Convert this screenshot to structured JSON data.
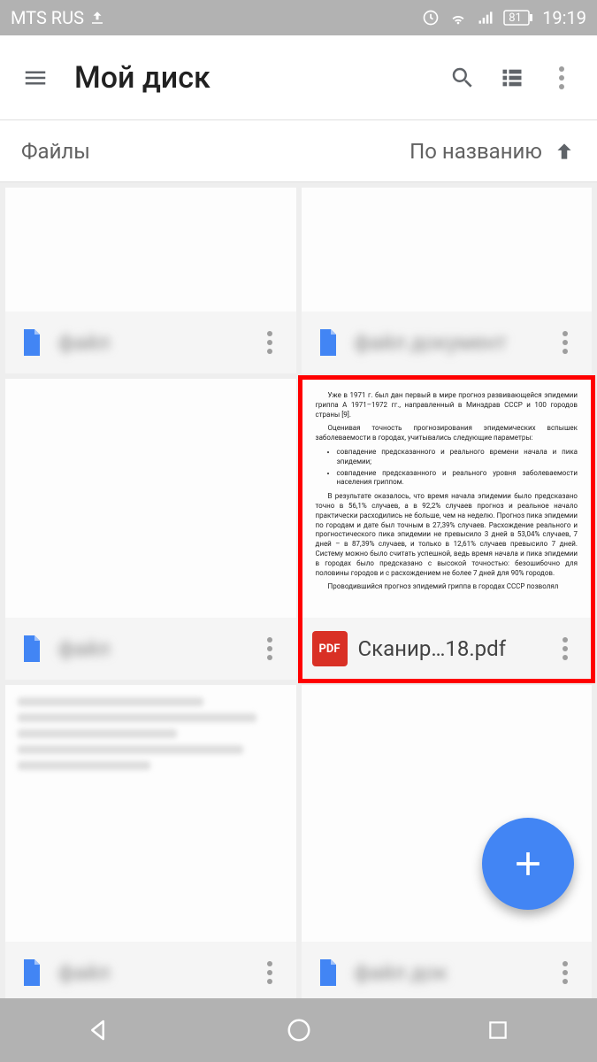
{
  "status": {
    "carrier": "MTS RUS",
    "battery": "81",
    "time": "19:19"
  },
  "header": {
    "title": "Мой диск"
  },
  "sort": {
    "section_label": "Файлы",
    "sort_label": "По названию"
  },
  "files": [
    {
      "name": "файл",
      "type": "doc",
      "blurred": true
    },
    {
      "name": "файл документ",
      "type": "doc",
      "blurred": true
    },
    {
      "name": "файл",
      "type": "doc",
      "blurred": true
    },
    {
      "name": "Сканир…18.pdf",
      "type": "pdf",
      "blurred": false
    },
    {
      "name": "файл",
      "type": "doc",
      "blurred": true
    },
    {
      "name": "файл док",
      "type": "doc",
      "blurred": true
    }
  ],
  "pdf_preview": {
    "p1": "Уже в 1971 г. был дан первый в мире прогноз развивающейся эпидемии гриппа А 1971–1972 гг., направленный в Минздрав СССР и 100 городов страны [9].",
    "p2": "Оценивая точность прогнозирования эпидемических вспышек заболеваемости в городах, учитывались следующие параметры:",
    "b1": "совпадение предсказанного и реального времени начала и пика эпидемии;",
    "b2": "совпадение предсказанного и реального уровня заболеваемости населения гриппом.",
    "p3": "В результате оказалось, что время начала эпидемии было предсказано точно в 56,1% случаев, а в 92,2% случаев прогноз и реальное начало практически расходились не больше, чем на неделю. Прогноз пика эпидемии по городам и дате был точным в 27,39% случаев. Расхождение реального и прогностического пика эпидемии не превысило 3 дней в 53,04% случаев, 7 дней – в 87,39% случаев, и только в 12,61% случаев превысило 7 дней. Систему можно было считать успешной, ведь время начала и пика эпидемии в городах было предсказано с высокой точностью: безошибочно для половины городов и с расхождением не более 7 дней для 90% городов.",
    "p4": "Проводившийся прогноз эпидемий гриппа в городах СССР позволял"
  },
  "pdf_badge": "PDF"
}
